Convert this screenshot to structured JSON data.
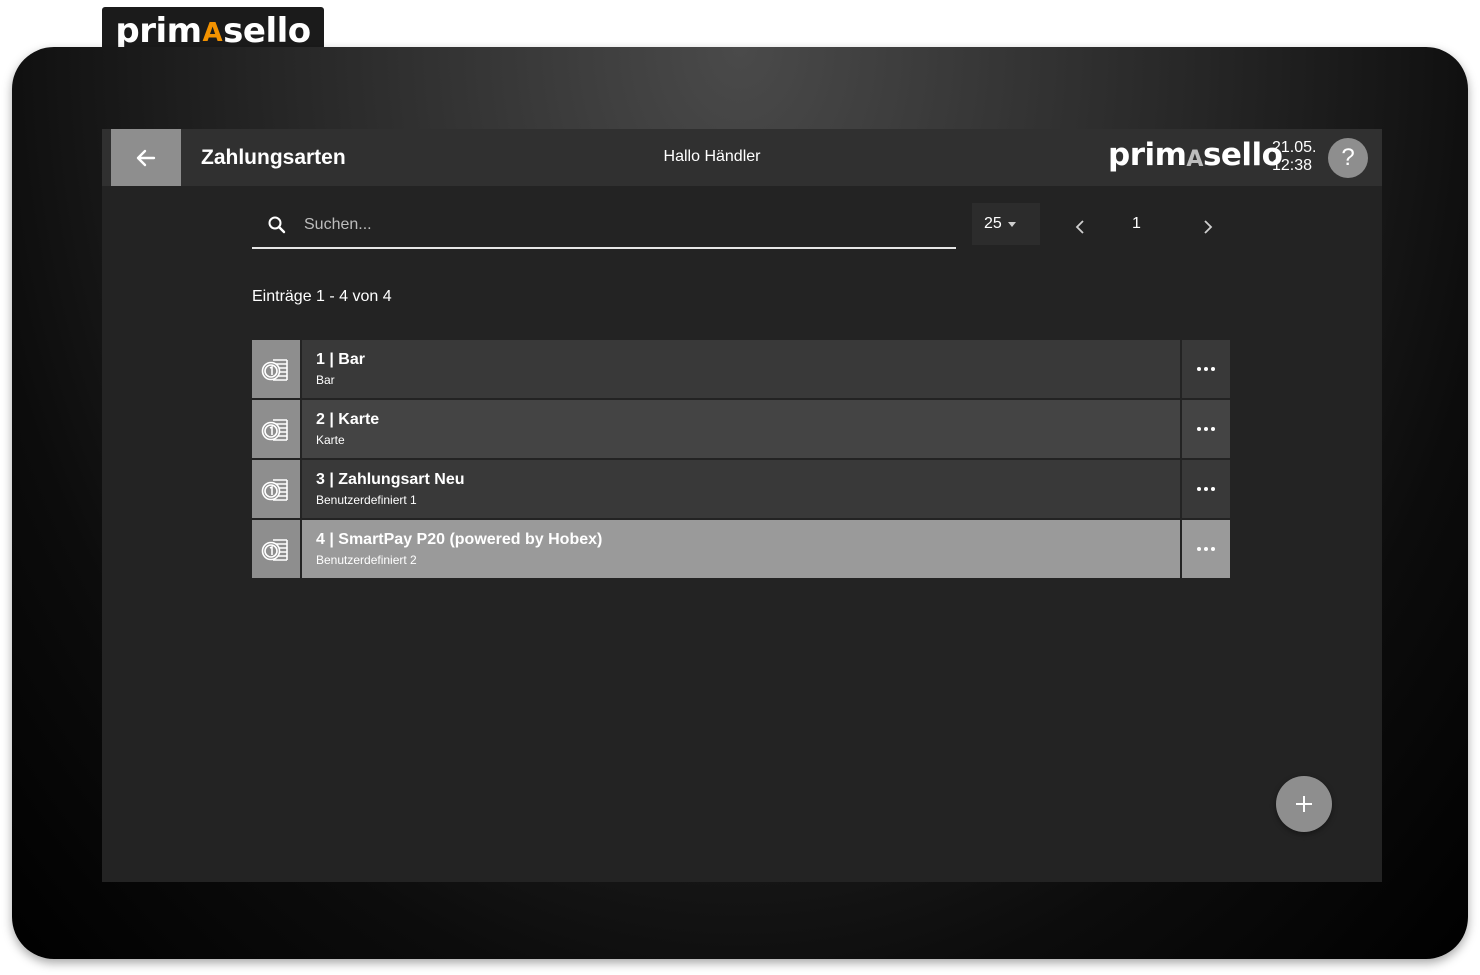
{
  "brand": {
    "prefix": "prim",
    "accent": "A",
    "suffix": "sello",
    "accent_color": "#f39200"
  },
  "header": {
    "title": "Zahlungsarten",
    "greeting": "Hallo Händler",
    "date": "21.05.",
    "time": "12:38",
    "help_label": "?",
    "back_icon": "arrow-left-icon"
  },
  "toolbar": {
    "search_placeholder": "Suchen...",
    "search_value": "",
    "page_size": "25",
    "page_number": "1"
  },
  "entries_label": "Einträge 1 - 4 von 4",
  "items": [
    {
      "title": "1 | Bar",
      "subtitle": "Bar",
      "icon": "coins-icon",
      "state": "normal"
    },
    {
      "title": "2 | Karte",
      "subtitle": "Karte",
      "icon": "coins-icon",
      "state": "alt"
    },
    {
      "title": "3 | Zahlungsart Neu",
      "subtitle": "Benutzerdefiniert 1",
      "icon": "coins-icon",
      "state": "normal"
    },
    {
      "title": "4 | SmartPay P20 (powered by Hobex)",
      "subtitle": "Benutzerdefiniert 2",
      "icon": "coins-icon",
      "state": "selected"
    }
  ],
  "colors": {
    "screen_bg": "#232323",
    "header_bg": "#303030",
    "button_gray": "#8e8e8e",
    "row_bg": "#393939",
    "row_selected_bg": "#9a9a9a"
  }
}
